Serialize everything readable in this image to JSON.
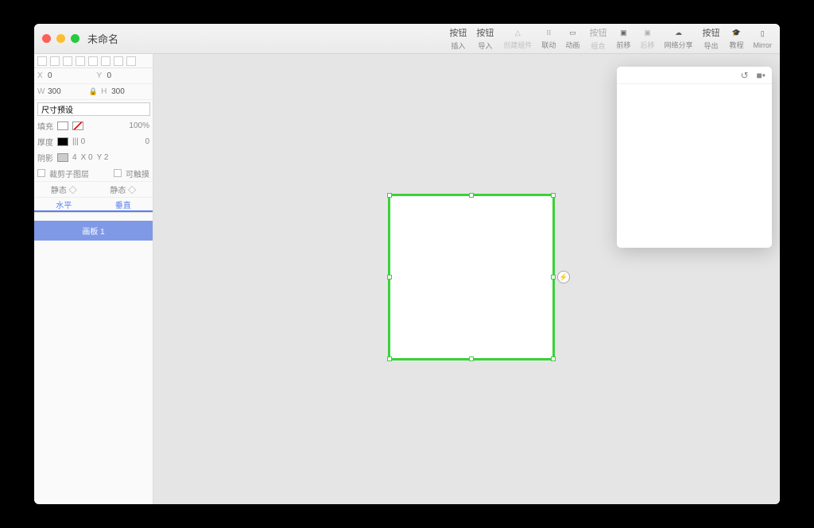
{
  "window": {
    "title": "未命名"
  },
  "toolbar": {
    "insert": {
      "main": "按钮",
      "sub": "插入"
    },
    "import": {
      "main": "按钮",
      "sub": "导入"
    },
    "makeComponent": {
      "main": "△",
      "sub": "创建组件"
    },
    "link": {
      "main": "⁝⁝",
      "sub": "联动"
    },
    "animate": {
      "main": "▭",
      "sub": "动画"
    },
    "group": {
      "main": "按钮",
      "sub": "组合"
    },
    "front": {
      "main": "▣",
      "sub": "前移"
    },
    "back": {
      "main": "▣",
      "sub": "后移"
    },
    "share": {
      "main": "☁",
      "sub": "网络分享"
    },
    "export": {
      "main": "按钮",
      "sub": "导出"
    },
    "tutorial": {
      "main": "🎓",
      "sub": "教程"
    },
    "mirror": {
      "main": "▯",
      "sub": "Mirror"
    }
  },
  "inspector": {
    "x": {
      "label": "X",
      "value": "0"
    },
    "y": {
      "label": "Y",
      "value": "0"
    },
    "w": {
      "label": "W",
      "value": "300"
    },
    "h": {
      "label": "H",
      "value": "300"
    },
    "sizePreset": "尺寸预设",
    "fillLabel": "填充",
    "fillOpacity": "100%",
    "strokeLabel": "厚度",
    "strokeStyle": "||| 0",
    "strokeVal": "0",
    "shadowLabel": "阴影",
    "shadowBlur": "4",
    "shadowX": "X 0",
    "shadowY": "Y 2",
    "clipLabel": "裁剪子图层",
    "touchLabel": "可触摸",
    "staticH": "静态 ◇",
    "staticV": "静态 ◇",
    "axisH": "水平",
    "axisV": "垂直"
  },
  "layers": {
    "artboard1": "画板 1"
  }
}
